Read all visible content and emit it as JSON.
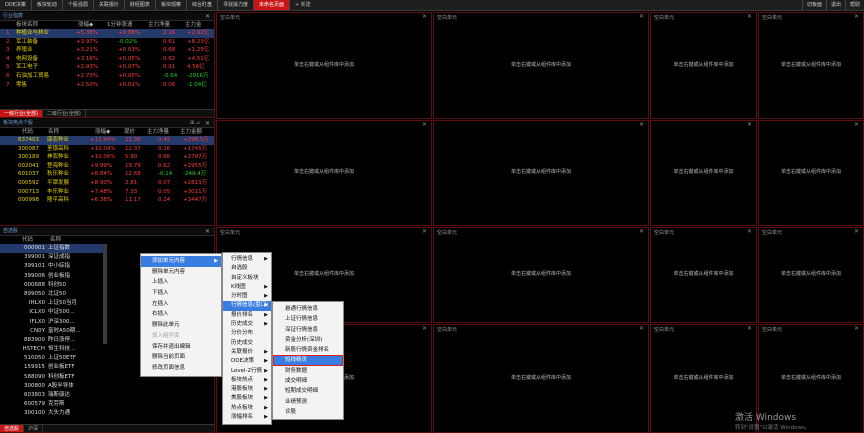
{
  "top_tabs": [
    "DDE决策",
    "板块轮动",
    "个股强弱",
    "关联报价",
    "财经图表",
    "板块观察",
    "综合盯盘",
    "寻找操力度",
    "未命名页面",
    "+ 新建"
  ],
  "top_right": [
    "切板面",
    "退出",
    "帮助"
  ],
  "industry_panel": {
    "title": "行业指数",
    "columns": [
      "板块名称",
      "涨幅◆",
      "1分钟涨速",
      "主力净量",
      "主力金"
    ],
    "rows": [
      {
        "n": "1",
        "name": "种植业与林业",
        "chg": "+5.38%",
        "spd": "+0.88%",
        "net": "2.26",
        "amt": "+2.92亿",
        "sel": true
      },
      {
        "n": "2",
        "name": "军工装备",
        "chg": "+3.97%",
        "spd": "-0.02%",
        "net": "0.61",
        "amt": "+8.23亿"
      },
      {
        "n": "3",
        "name": "养殖业",
        "chg": "+3.21%",
        "spd": "+0.03%",
        "net": "0.68",
        "amt": "+1.25亿"
      },
      {
        "n": "4",
        "name": "电网设备",
        "chg": "+3.16%",
        "spd": "+0.05%",
        "net": "0.62",
        "amt": "+4.51亿"
      },
      {
        "n": "5",
        "name": "军工电子",
        "chg": "+2.93%",
        "spd": "+0.07%",
        "net": "0.91",
        "amt": "4.56亿"
      },
      {
        "n": "6",
        "name": "石油加工贸易",
        "chg": "+2.73%",
        "spd": "+0.05%",
        "net": "-0.64",
        "amt": "-2916万"
      },
      {
        "n": "7",
        "name": "零售",
        "chg": "+2.50%",
        "spd": "+0.01%",
        "net": "0.06",
        "amt": "-1.04亿"
      }
    ],
    "bottom_tabs": [
      "一级行业(全部)",
      "二级行业(全部)"
    ]
  },
  "hot_panel": {
    "title": "板块热点个股",
    "columns": [
      "代码",
      "名称",
      "涨幅◆",
      "现价",
      "主力净量",
      "主力金额"
    ],
    "rows": [
      {
        "code": "837403",
        "name": "康农种业",
        "chg": "+12.94%",
        "price": "21.38",
        "net": "0.45",
        "amt": "+298.5万",
        "sel": true
      },
      {
        "code": "300087",
        "name": "荃银高科",
        "chg": "+10.04%",
        "price": "12.37",
        "net": "0.16",
        "amt": "+1745万"
      },
      {
        "code": "300189",
        "name": "神农种业",
        "chg": "+10.06%",
        "price": "5.80",
        "net": "0.66",
        "amt": "+2797万"
      },
      {
        "code": "002041",
        "name": "登海种业",
        "chg": "+9.99%",
        "price": "19.79",
        "net": "0.62",
        "amt": "+2955万"
      },
      {
        "code": "601037",
        "name": "秋乐种业",
        "chg": "+8.84%",
        "price": "12.68",
        "net": "-0.14",
        "amt": "-249.4万"
      },
      {
        "code": "000592",
        "name": "平潭发展",
        "chg": "+8.90%",
        "price": "2.81",
        "net": "0.07",
        "amt": "+2813万"
      },
      {
        "code": "000713",
        "name": "丰乐种业",
        "chg": "+7.48%",
        "price": "7.33",
        "net": "0.05",
        "amt": "+3011万"
      },
      {
        "code": "000998",
        "name": "隆平高科",
        "chg": "+6.38%",
        "price": "11.17",
        "net": "0.24",
        "amt": "+3447万"
      }
    ]
  },
  "index_panel": {
    "title": "自选股",
    "columns": [
      "代码",
      "名称"
    ],
    "rows": [
      {
        "code": "000001",
        "name": "上证指数",
        "sel": true
      },
      {
        "code": "399001",
        "name": "深证成指"
      },
      {
        "code": "399101",
        "name": "中小综指"
      },
      {
        "code": "399006",
        "name": "创业板指"
      },
      {
        "code": "000688",
        "name": "科创50"
      },
      {
        "code": "899050",
        "name": "北证50"
      },
      {
        "code": "IHLX0",
        "name": "上证50当月"
      },
      {
        "code": "ICLX0",
        "name": "中证500..."
      },
      {
        "code": "IFLX0",
        "name": "沪深300..."
      },
      {
        "code": "CN0Y",
        "name": "富时A50期..."
      },
      {
        "code": "883900",
        "name": "昨日涨停..."
      },
      {
        "code": "HSTECH",
        "name": "恒生科技..."
      },
      {
        "code": "510050",
        "name": "上证50ETF"
      },
      {
        "code": "159915",
        "name": "创业板ETF"
      },
      {
        "code": "588090",
        "name": "科创板ETF"
      },
      {
        "code": "300800",
        "name": "A股半导体"
      },
      {
        "code": "603803",
        "name": "瑞斯康达"
      },
      {
        "code": "600579",
        "name": "克劳斯"
      },
      {
        "code": "300100",
        "name": "大头力通"
      }
    ],
    "bottom_tabs": [
      "自选股",
      "沪深"
    ]
  },
  "empty_cell": {
    "title": "空白单元",
    "hint": "单击右键或从组件库中添加"
  },
  "context_menu_main": [
    {
      "label": "添加单元内容",
      "arrow": true,
      "hl": true
    },
    {
      "label": "删除单元内容"
    },
    {
      "label": "上插入"
    },
    {
      "label": "下插入"
    },
    {
      "label": "左插入"
    },
    {
      "label": "右插入"
    },
    {
      "label": "删除此单元"
    },
    {
      "label": "加入组件库",
      "dis": true
    },
    {
      "label": "保存并退出编辑"
    },
    {
      "label": "删除当前页面"
    },
    {
      "label": "修改页面信息"
    }
  ],
  "context_menu_sub": [
    {
      "label": "行情信息",
      "arrow": true
    },
    {
      "label": "自选股"
    },
    {
      "label": "自定义板块"
    },
    {
      "label": "K线图",
      "arrow": true
    },
    {
      "label": "分时图",
      "arrow": true
    },
    {
      "label": "行情信息(盘口)",
      "arrow": true,
      "hl": true
    },
    {
      "label": "报价排名",
      "arrow": true
    },
    {
      "label": "历史成交",
      "arrow": true
    },
    {
      "label": "分价分布"
    },
    {
      "label": "历史成交"
    },
    {
      "label": "关联报价",
      "arrow": true
    },
    {
      "label": "DDE决策",
      "arrow": true
    },
    {
      "label": "Level-2行情",
      "arrow": true
    },
    {
      "label": "板块热点",
      "arrow": true
    },
    {
      "label": "港股板块",
      "arrow": true
    },
    {
      "label": "美股板块",
      "arrow": true
    },
    {
      "label": "热点板块",
      "arrow": true
    },
    {
      "label": "涨幅排名",
      "arrow": true
    }
  ],
  "context_menu_third": [
    {
      "label": "悬通行情信息"
    },
    {
      "label": "上证行情信息"
    },
    {
      "label": "深证行情信息"
    },
    {
      "label": "资金分析(深圳)"
    },
    {
      "label": "新股行情资金排名"
    },
    {
      "label": "短线精灵",
      "hl": true
    },
    {
      "label": "财务数据"
    },
    {
      "label": "成交明细"
    },
    {
      "label": "短期成交明细"
    },
    {
      "label": "业绩预测"
    },
    {
      "label": "诊股"
    }
  ],
  "watermark": {
    "line1": "激活 Windows",
    "line2": "转到\"设置\"以激活 Windows。"
  }
}
